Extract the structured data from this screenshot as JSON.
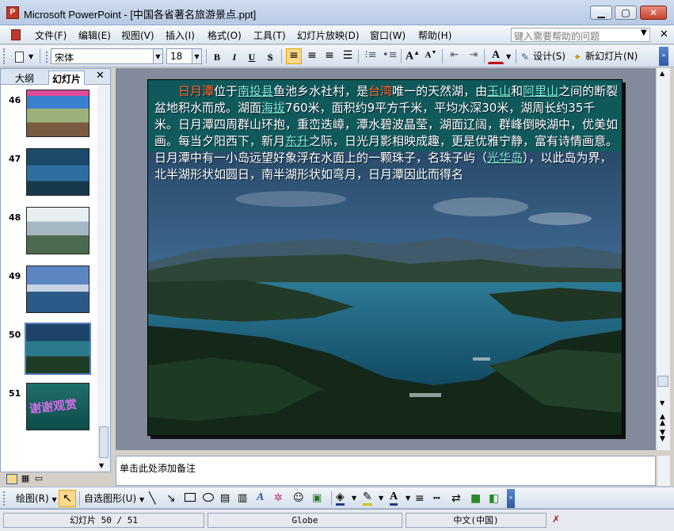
{
  "window": {
    "app_icon_glyph": "P",
    "title": "Microsoft PowerPoint - [中国各省著名旅游景点.ppt]",
    "controls": [
      "▁",
      "▢",
      "✕"
    ]
  },
  "menu": {
    "items": [
      "文件(F)",
      "编辑(E)",
      "视图(V)",
      "插入(I)",
      "格式(O)",
      "工具(T)",
      "幻灯片放映(D)",
      "窗口(W)",
      "帮助(H)"
    ],
    "help_placeholder": "键入需要帮助的问题"
  },
  "toolbar": {
    "font_name": "宋体",
    "font_size": "18",
    "bold": "B",
    "italic": "I",
    "underline": "U",
    "shadow": "S",
    "design_label": "设计(S)",
    "new_slide_label": "新幻灯片(N)"
  },
  "left_panel": {
    "tabs": [
      "大纲",
      "幻灯片"
    ],
    "close": "✕",
    "thumbnails": [
      {
        "number": "46"
      },
      {
        "number": "47"
      },
      {
        "number": "48"
      },
      {
        "number": "49"
      },
      {
        "number": "50"
      },
      {
        "number": "51",
        "caption": "谢谢观赏"
      }
    ]
  },
  "slide": {
    "paragraph": [
      {
        "t": "日月潭",
        "k": "hi"
      },
      {
        "t": "位于",
        "k": "n"
      },
      {
        "t": "南投县",
        "k": "lk"
      },
      {
        "t": "鱼池乡水社村，是",
        "k": "n"
      },
      {
        "t": "台湾",
        "k": "hi"
      },
      {
        "t": "唯一的天然湖，由",
        "k": "n"
      },
      {
        "t": "玉山",
        "k": "lk"
      },
      {
        "t": "和",
        "k": "n"
      },
      {
        "t": "阿里山",
        "k": "lk"
      },
      {
        "t": "之间的断裂盆地积水而成。湖面",
        "k": "n"
      },
      {
        "t": "海拔",
        "k": "lk"
      },
      {
        "t": "760米，面积约9平方千米，平均水深30米，湖周长约35千米。日月潭四周群山环抱，重峦迭嶂，潭水碧波晶莹，湖面辽阔，群峰倒映湖中，优美如画。每当夕阳西下，新月",
        "k": "n"
      },
      {
        "t": "东升",
        "k": "lk"
      },
      {
        "t": "之际，日光月影相映成趣，更是优雅宁静，富有诗情画意。日月潭中有一小岛远望好象浮在水面上的一颗珠子，名珠子屿（",
        "k": "n"
      },
      {
        "t": "光华岛",
        "k": "lk"
      },
      {
        "t": "），以此岛为界，北半湖形状如圆日，南半湖形状如弯月，日月潭因此而得名",
        "k": "n"
      }
    ]
  },
  "notes": {
    "placeholder": "单击此处添加备注"
  },
  "drawing": {
    "draw_label": "绘图(R)",
    "autoshape_label": "自选图形(U)"
  },
  "status": {
    "slide_position": "幻灯片 50 / 51",
    "template": "Globe",
    "language": "中文(中国)"
  }
}
